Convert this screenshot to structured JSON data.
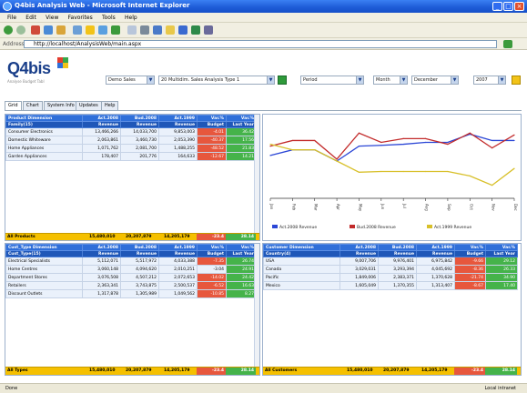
{
  "window": {
    "title": "Q4bis Analysis Web - Microsoft Internet Explorer"
  },
  "menu": [
    "File",
    "Edit",
    "View",
    "Favorites",
    "Tools",
    "Help"
  ],
  "address": {
    "label": "Address",
    "url": "http://localhost/AnalysisWeb/main.aspx"
  },
  "logo": {
    "name": "Q4bis",
    "tagline": "Analyse  Budget  Tabl"
  },
  "filters": {
    "cube": "Demo Sales",
    "view": "20 Multidim. Sales Analysis Type 1",
    "period_type": "Period",
    "period_unit": "Month",
    "month": "December",
    "year": "2007"
  },
  "tabs": [
    "Grid",
    "Chart",
    "System Info",
    "Updates",
    "Help"
  ],
  "product_grid": {
    "dim": "Product Dimension",
    "level": "Family(15)",
    "columns": [
      {
        "top": "Act.2008",
        "bottom": "Revenue"
      },
      {
        "top": "Bud.2008",
        "bottom": "Revenue"
      },
      {
        "top": "Act.1999",
        "bottom": "Revenue"
      },
      {
        "top": "Var.%",
        "bottom": "Budget"
      },
      {
        "top": "Var.%",
        "bottom": "Last Year"
      }
    ],
    "rows": [
      {
        "name": "Consumer Electronics",
        "v": [
          "13,466,266",
          "14,033,700",
          "9,853,003",
          "-4.01",
          "36.42"
        ]
      },
      {
        "name": "Domestic Whiteware",
        "v": [
          "2,063,861",
          "3,460,730",
          "2,053,390",
          "-40.37",
          "17.56"
        ]
      },
      {
        "name": "Home Appliances",
        "v": [
          "1,071,762",
          "2,081,700",
          "1,488,255",
          "-48.52",
          "21.83"
        ]
      },
      {
        "name": "Garden Appliances",
        "v": [
          "178,407",
          "201,776",
          "164,633",
          "-12.67",
          "14.21"
        ]
      }
    ],
    "total": {
      "label": "All Products",
      "v": [
        "15,480,010",
        "20,207,879",
        "14,205,179",
        "-23.4",
        "28.14"
      ]
    }
  },
  "chart_data": {
    "type": "line",
    "x": [
      "Jan",
      "Feb",
      "Mar",
      "Apr",
      "May",
      "Jun",
      "Jul",
      "Aug",
      "Sep",
      "Oct",
      "Nov",
      "Dec"
    ],
    "series": [
      {
        "name": "Act.2008 Revenue",
        "color": "#2b46d6",
        "values": [
          1.15,
          1.3,
          1.3,
          1.0,
          1.4,
          1.42,
          1.45,
          1.5,
          1.5,
          1.72,
          1.55,
          1.55
        ]
      },
      {
        "name": "Bud.2008 Revenue",
        "color": "#c22a2a",
        "values": [
          1.4,
          1.55,
          1.55,
          1.05,
          1.75,
          1.5,
          1.6,
          1.6,
          1.45,
          1.75,
          1.35,
          1.7
        ]
      },
      {
        "name": "Act.1999 Revenue",
        "color": "#d8c02a",
        "values": [
          1.45,
          1.3,
          1.3,
          1.0,
          0.7,
          0.72,
          0.72,
          0.72,
          0.72,
          0.6,
          0.35,
          0.8
        ]
      }
    ],
    "ylim": [
      0,
      2
    ],
    "legend": "bottom",
    "grid": false
  },
  "custtype_grid": {
    "dim": "Cust_Type Dimension",
    "level": "Cust_Type(15)",
    "columns": [
      {
        "top": "Act.2008",
        "bottom": "Revenue"
      },
      {
        "top": "Bud.2008",
        "bottom": "Revenue"
      },
      {
        "top": "Act.1999",
        "bottom": "Revenue"
      },
      {
        "top": "Var.%",
        "bottom": "Budget"
      },
      {
        "top": "Var.%",
        "bottom": "Last Year"
      }
    ],
    "rows": [
      {
        "name": "Electrical Specialists",
        "v": [
          "5,112,071",
          "5,517,972",
          "4,033,388",
          "-7.35",
          "26.74"
        ]
      },
      {
        "name": "Home Centres",
        "v": [
          "3,060,148",
          "4,094,620",
          "2,010,251",
          "-3.04",
          "24.91"
        ]
      },
      {
        "name": "Department Stores",
        "v": [
          "3,076,508",
          "4,507,212",
          "2,072,653",
          "-14.02",
          "24.42"
        ]
      },
      {
        "name": "Retailers",
        "v": [
          "2,363,341",
          "3,743,875",
          "2,500,537",
          "-6.52",
          "16.63"
        ]
      },
      {
        "name": "Discount Outlets",
        "v": [
          "1,317,878",
          "1,305,989",
          "1,049,562",
          "-10.85",
          "8.27"
        ]
      }
    ],
    "total": {
      "label": "All Types",
      "v": [
        "15,480,010",
        "20,207,879",
        "14,205,179",
        "-23.4",
        "28.14"
      ]
    }
  },
  "customer_grid": {
    "dim": "Customer Dimension",
    "level": "Country(4)",
    "columns": [
      {
        "top": "Act.2008",
        "bottom": "Revenue"
      },
      {
        "top": "Bud.2008",
        "bottom": "Revenue"
      },
      {
        "top": "Act.1999",
        "bottom": "Revenue"
      },
      {
        "top": "Var.%",
        "bottom": "Budget"
      },
      {
        "top": "Var.%",
        "bottom": "Last Year"
      }
    ],
    "rows": [
      {
        "name": "USA",
        "v": [
          "9,007,706",
          "9,976,401",
          "6,975,842",
          "-9.66",
          "29.12"
        ]
      },
      {
        "name": "Canada",
        "v": [
          "3,029,031",
          "3,293,394",
          "4,045,692",
          "-8.36",
          "26.33"
        ]
      },
      {
        "name": "Pacific",
        "v": [
          "1,849,006",
          "2,383,371",
          "1,370,628",
          "-21.74",
          "34.90"
        ]
      },
      {
        "name": "Mexico",
        "v": [
          "1,605,049",
          "1,370,355",
          "1,313,407",
          "-8.67",
          "17.40"
        ]
      }
    ],
    "total": {
      "label": "All Customers",
      "v": [
        "15,480,010",
        "20,207,879",
        "14,205,179",
        "-23.4",
        "28.14"
      ]
    }
  },
  "status": {
    "left": "Done",
    "right": "Local intranet"
  }
}
